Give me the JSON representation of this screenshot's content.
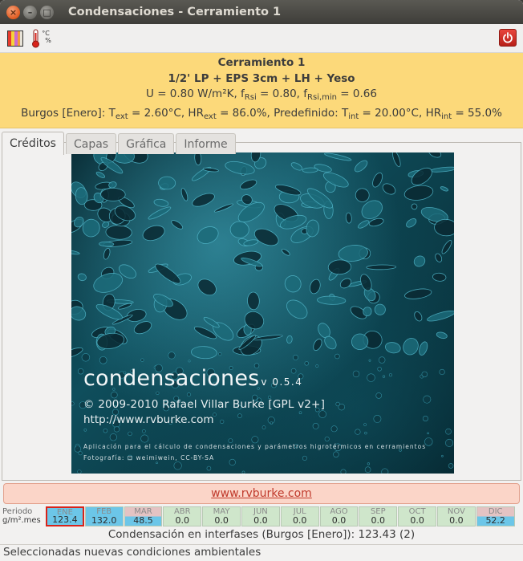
{
  "window": {
    "title": "Condensaciones - Cerramiento 1"
  },
  "toolbar": {
    "left_icons": [
      "layers-icon",
      "thermometer-icon"
    ],
    "thermo_units": [
      "°C",
      "%"
    ],
    "right_icon": "power-icon"
  },
  "info": {
    "name": "Cerramiento 1",
    "composition": "1/2' LP + EPS 3cm + LH + Yeso",
    "line3": {
      "u": "U = 0.80 W/m²K, f",
      "rsi_sub": "Rsi",
      "mid": " = 0.80, f",
      "rsimin_sub": "Rsi,min",
      "end": " = 0.66"
    },
    "line4": {
      "a": "Burgos [Enero]: T",
      "ext1": "ext",
      "b": " = 2.60°C, HR",
      "ext2": "ext",
      "c": " = 86.0%, Predefinido: T",
      "int1": "int",
      "d": " = 20.00°C, HR",
      "int2": "int",
      "e": " = 55.0%"
    },
    "bg_color": "#fcd97a"
  },
  "tabs": [
    "Créditos",
    "Capas",
    "Gráfica",
    "Informe"
  ],
  "active_tab": 0,
  "splash": {
    "app_name": "condensaciones",
    "version": "v 0.5.4",
    "copyright": "© 2009-2010 Rafael Villar Burke [GPL v2+]",
    "url": "http://www.rvburke.com",
    "description": "Aplicación para el cálculo de condensaciones y parámetros higrotérmicos en cerramientos",
    "photo_credit": "Fotografía: ⊡ weimiwein, CC-BY-SA"
  },
  "link": {
    "text": "www.rvburke.com"
  },
  "period": {
    "label": "Periodo",
    "unit": "g/m².mes"
  },
  "months": [
    {
      "name": "ENE",
      "value": "123.4",
      "fill": 1.0,
      "color": "#6cc6e8",
      "selected": true
    },
    {
      "name": "FEB",
      "value": "132.0",
      "fill": 1.0,
      "color": "#6cc6e8",
      "selected": false
    },
    {
      "name": "MAR",
      "value": "48.5",
      "fill": 0.5,
      "color": "#6cc6e8",
      "selected": false
    },
    {
      "name": "ABR",
      "value": "0.0",
      "fill": 0,
      "color": "#cfe6cb",
      "selected": false
    },
    {
      "name": "MAY",
      "value": "0.0",
      "fill": 0,
      "color": "#cfe6cb",
      "selected": false
    },
    {
      "name": "JUN",
      "value": "0.0",
      "fill": 0,
      "color": "#cfe6cb",
      "selected": false
    },
    {
      "name": "JUL",
      "value": "0.0",
      "fill": 0,
      "color": "#cfe6cb",
      "selected": false
    },
    {
      "name": "AGO",
      "value": "0.0",
      "fill": 0,
      "color": "#cfe6cb",
      "selected": false
    },
    {
      "name": "SEP",
      "value": "0.0",
      "fill": 0,
      "color": "#cfe6cb",
      "selected": false
    },
    {
      "name": "OCT",
      "value": "0.0",
      "fill": 0,
      "color": "#cfe6cb",
      "selected": false
    },
    {
      "name": "NOV",
      "value": "0.0",
      "fill": 0,
      "color": "#cfe6cb",
      "selected": false
    },
    {
      "name": "DIC",
      "value": "52.2",
      "fill": 0.5,
      "color": "#6cc6e8",
      "selected": false
    }
  ],
  "summary": "Condensación en interfases (Burgos [Enero]): 123.43 (2)",
  "status": "Seleccionadas nuevas condiciones ambientales"
}
